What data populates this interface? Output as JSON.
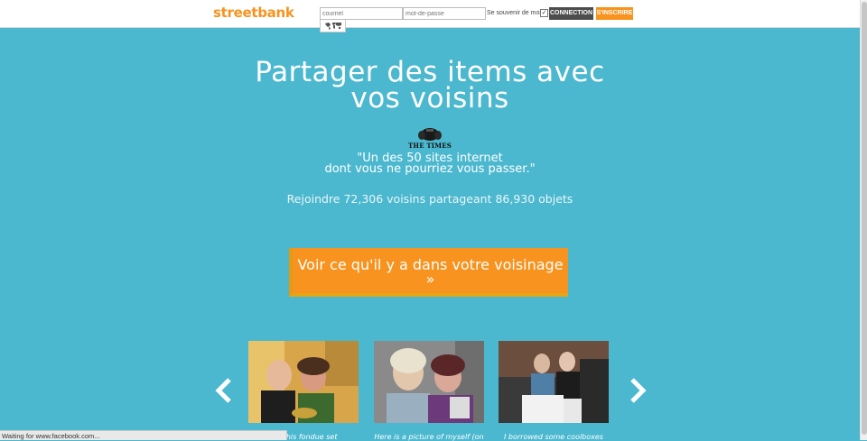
{
  "header": {
    "logo_text": "streetbank",
    "email_placeholder": "courriel",
    "password_placeholder": "mot-de-passe",
    "remember_label": "Se souvenir de moi",
    "remember_checked": true,
    "login_button": "CONNECTION",
    "signup_button": "S'INSCRIRE",
    "map_icon": "world-map-icon"
  },
  "hero": {
    "title_line1": "Partager des items avec",
    "title_line2": "vos voisins",
    "press_logo": "THE TIMES",
    "quote_line1": "\"Un des 50 sites internet",
    "quote_line2": "dont vous ne pourriez vous passer.\"",
    "join_text": "Rejoindre 72,306 voisins partageant 86,930 objets",
    "cta_line1": "Voir ce qu'il y a dans votre voisinage",
    "cta_line2": "»"
  },
  "carousel": {
    "prev_icon": "chevron-left-icon",
    "next_icon": "chevron-right-icon",
    "items": [
      {
        "caption": "...u this fondue set"
      },
      {
        "caption": "Here is a picture of myself (on"
      },
      {
        "caption": "I borrowed some coolboxes"
      }
    ]
  },
  "status_bar": {
    "text": "Waiting for www.facebook.com..."
  },
  "colors": {
    "background": "#4bb8cf",
    "accent": "#f7931e",
    "dark_button": "#4d4d4d"
  }
}
